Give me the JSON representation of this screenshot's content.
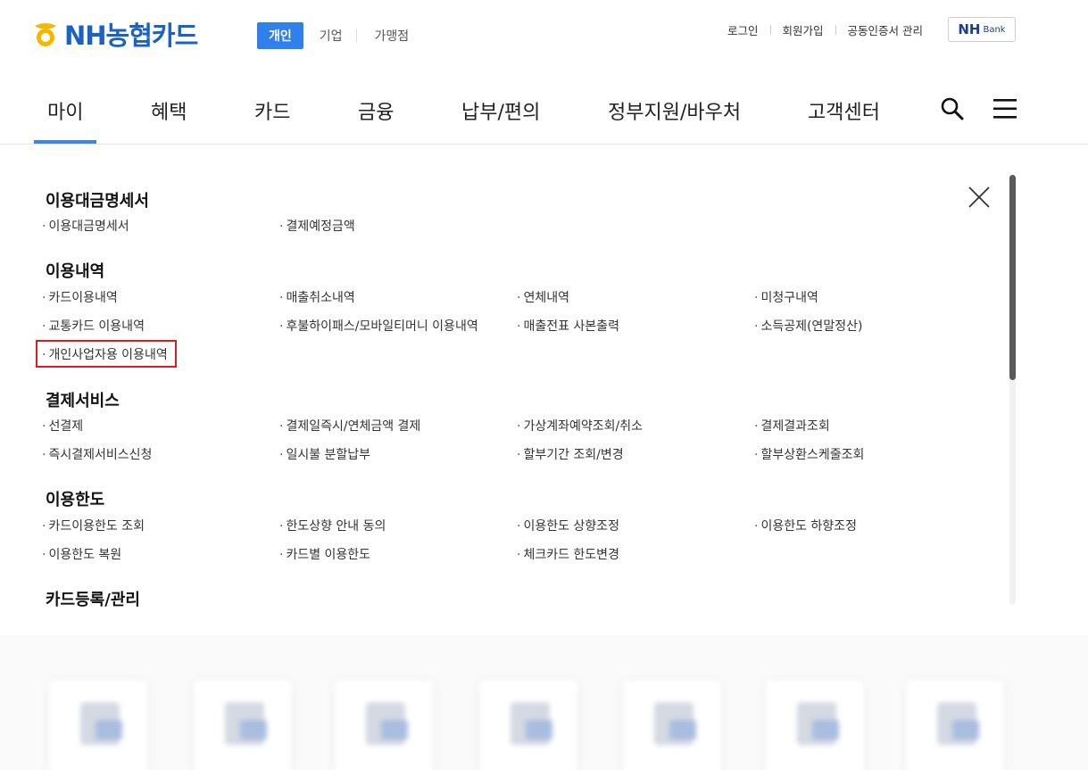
{
  "header": {
    "logo_text": "NH농협카드",
    "segments": [
      "개인",
      "기업",
      "가맹점"
    ],
    "util_links": [
      "로그인",
      "회원가입",
      "공동인증서 관리"
    ],
    "bank_badge_main": "NH",
    "bank_badge_sub": "Bank"
  },
  "nav": {
    "items": [
      "마이",
      "혜택",
      "카드",
      "금융",
      "납부/편의",
      "정부지원/바우처",
      "고객센터"
    ],
    "active": "마이"
  },
  "menu": {
    "sections": [
      {
        "title": "이용대금명세서",
        "links": [
          "이용대금명세서",
          "결제예정금액"
        ]
      },
      {
        "title": "이용내역",
        "links": [
          "카드이용내역",
          "매출취소내역",
          "연체내역",
          "미청구내역",
          "교통카드 이용내역",
          "후불하이패스/모바일티머니 이용내역",
          "매출전표 사본출력",
          "소득공제(연말정산)",
          "개인사업자용 이용내역"
        ]
      },
      {
        "title": "결제서비스",
        "links": [
          "선결제",
          "결제일즉시/연체금액 결제",
          "가상계좌예약조회/취소",
          "결제결과조회",
          "즉시결제서비스신청",
          "일시불 분할납부",
          "할부기간 조회/변경",
          "할부상환스케줄조회"
        ]
      },
      {
        "title": "이용한도",
        "links": [
          "카드이용한도 조회",
          "한도상향 안내 동의",
          "이용한도 상향조정",
          "이용한도 하향조정",
          "이용한도 복원",
          "카드별 이용한도",
          "체크카드 한도변경"
        ]
      },
      {
        "title": "카드등록/관리",
        "links": []
      }
    ],
    "highlighted_link": "개인사업자용 이용내역"
  },
  "colors": {
    "brand_blue": "#1b62c3",
    "segment_active": "#2f80ed",
    "nav_active_bar": "#3a87f0",
    "highlight_border": "#e21a1a",
    "logo_yellow": "#f5b800"
  }
}
